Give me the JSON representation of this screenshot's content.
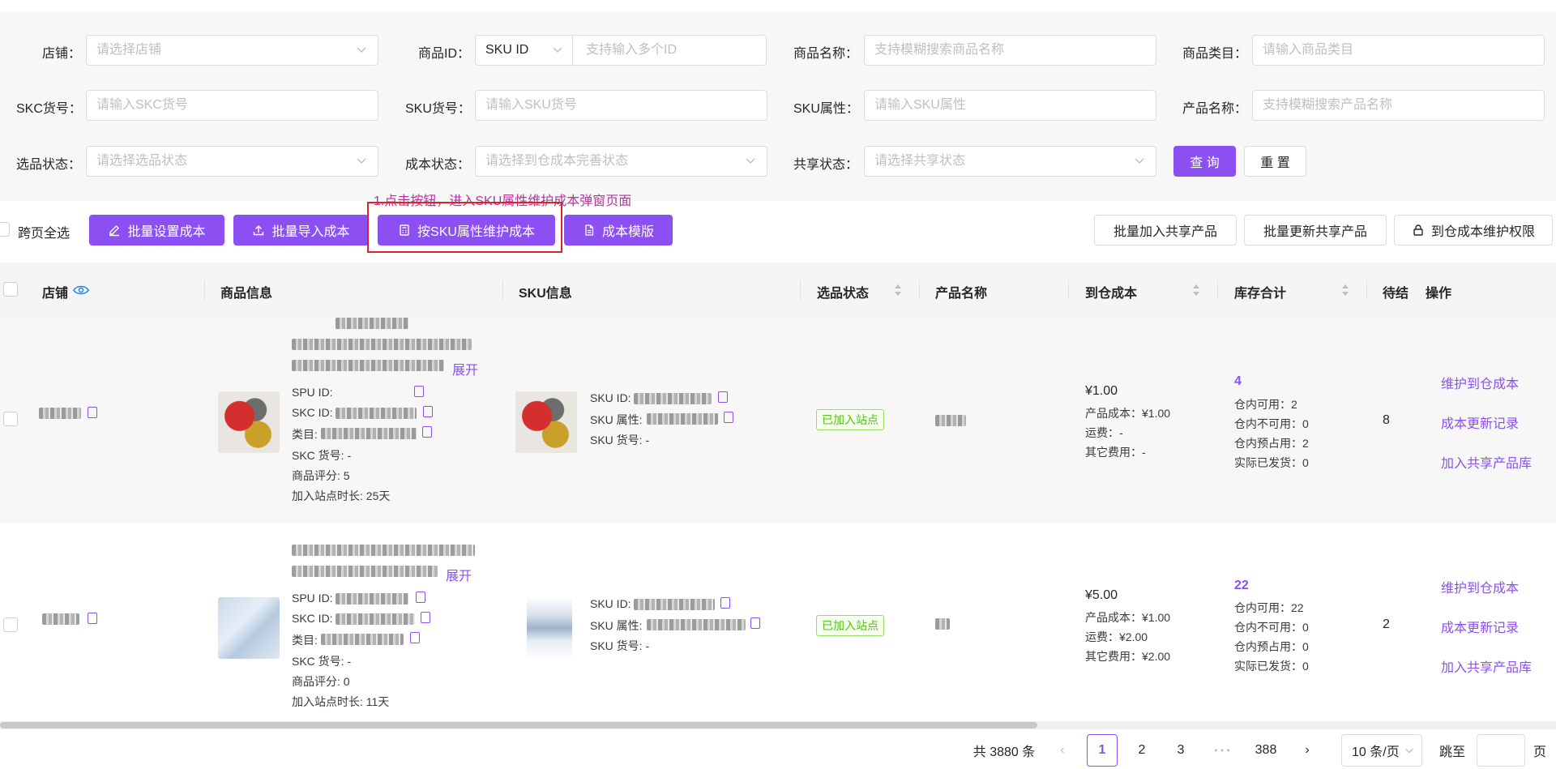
{
  "filters": {
    "row1": [
      {
        "label": "店铺：",
        "placeholder": "请选择店铺"
      },
      {
        "label": "商品ID：",
        "select": "SKU ID",
        "placeholder": "支持输入多个ID"
      },
      {
        "label": "商品名称：",
        "placeholder": "支持模糊搜索商品名称"
      },
      {
        "label": "商品类目：",
        "placeholder": "请输入商品类目"
      }
    ],
    "row2": [
      {
        "label": "SKC货号：",
        "placeholder": "请输入SKC货号"
      },
      {
        "label": "SKU货号：",
        "placeholder": "请输入SKU货号"
      },
      {
        "label": "SKU属性：",
        "placeholder": "请输入SKU属性"
      },
      {
        "label": "产品名称：",
        "placeholder": "支持模糊搜索产品名称"
      }
    ],
    "row3": [
      {
        "label": "选品状态：",
        "placeholder": "请选择选品状态"
      },
      {
        "label": "成本状态：",
        "placeholder": "请选择到仓成本完善状态"
      },
      {
        "label": "共享状态：",
        "placeholder": "请选择共享状态"
      }
    ],
    "query": "查 询",
    "reset": "重 置"
  },
  "annotation": "1.点击按钮，进入SKU属性维护成本弹窗页面",
  "toolbar": {
    "select_all": "跨页全选",
    "batch_set_cost": "批量设置成本",
    "batch_import_cost": "批量导入成本",
    "maintain_by_sku": "按SKU属性维护成本",
    "cost_template": "成本模版",
    "batch_add_shared": "批量加入共享产品",
    "batch_update_shared": "批量更新共享产品",
    "permission": "到仓成本维护权限"
  },
  "columns": {
    "store": "店铺",
    "product_info": "商品信息",
    "sku_info": "SKU信息",
    "select_status": "选品状态",
    "product_name": "产品名称",
    "warehouse_cost": "到仓成本",
    "stock_total": "库存合计",
    "pending": "待结",
    "actions": "操作"
  },
  "rows": [
    {
      "expand": "展开",
      "spu_label": "SPU ID:",
      "skc_label": "SKC ID:",
      "category_label": "类目:",
      "skc_no": "SKC 货号: -",
      "rating": "商品评分: 5",
      "days": "加入站点时长: 25天",
      "sku_id_label": "SKU ID:",
      "sku_attr_label": "SKU 属性:",
      "sku_no": "SKU 货号: -",
      "status": "已加入站点",
      "cost": "¥1.00",
      "product_cost": "产品成本：¥1.00",
      "freight": "运费：-",
      "other_cost": "其它费用：-",
      "stock": "4",
      "available": "仓内可用：2",
      "unavailable": "仓内不可用：0",
      "reserved": "仓内预占用：2",
      "shipped": "实际已发货：0",
      "pending": "8",
      "op1": "维护到仓成本",
      "op2": "成本更新记录",
      "op3": "加入共享产品库"
    },
    {
      "expand": "展开",
      "spu_label": "SPU ID:",
      "skc_label": "SKC ID:",
      "category_label": "类目:",
      "skc_no": "SKC 货号: -",
      "rating": "商品评分: 0",
      "days": "加入站点时长: 11天",
      "sku_id_label": "SKU ID:",
      "sku_attr_label": "SKU 属性:",
      "sku_no": "SKU 货号: -",
      "status": "已加入站点",
      "cost": "¥5.00",
      "product_cost": "产品成本：¥1.00",
      "freight": "运费：¥2.00",
      "other_cost": "其它费用：¥2.00",
      "stock": "22",
      "available": "仓内可用：22",
      "unavailable": "仓内不可用：0",
      "reserved": "仓内预占用：0",
      "shipped": "实际已发货：0",
      "pending": "2",
      "op1": "维护到仓成本",
      "op2": "成本更新记录",
      "op3": "加入共享产品库"
    }
  ],
  "pagination": {
    "total": "共 3880 条",
    "pages": [
      "1",
      "2",
      "3",
      "388"
    ],
    "ellipsis": "• • •",
    "page_size": "10 条/页",
    "jump_to": "跳至",
    "page_unit": "页"
  },
  "colors": {
    "primary": "#8c4ff2",
    "annotation": "#b0369c",
    "highlight": "#d9242a",
    "tag_green": "#52c41a"
  }
}
